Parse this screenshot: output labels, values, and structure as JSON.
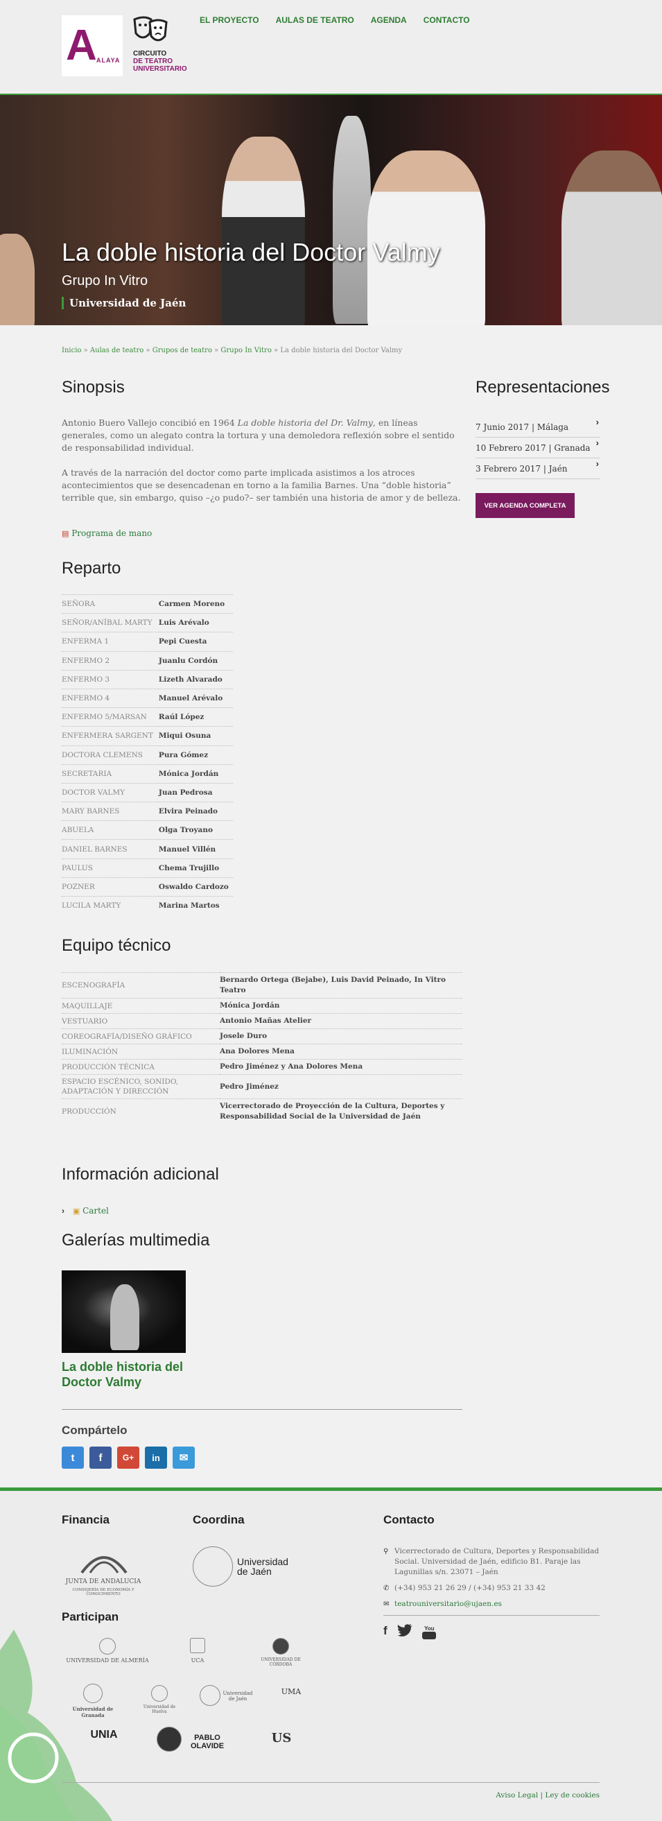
{
  "header": {
    "nav": [
      "EL PROYECTO",
      "AULAS DE TEATRO",
      "AGENDA",
      "CONTACTO"
    ],
    "logo_a_big": "A",
    "logo_a_text": "ALAYA",
    "logo_c_line1": "CIRCUITO",
    "logo_c_line2": "DE TEATRO",
    "logo_c_line3": "UNIVERSITARIO"
  },
  "hero": {
    "title": "La doble historia del Doctor Valmy",
    "group": "Grupo In Vitro",
    "university": "Universidad de Jaén"
  },
  "breadcrumb": {
    "items": [
      "Inicio",
      "Aulas de teatro",
      "Grupos de teatro",
      "Grupo In Vitro"
    ],
    "sep": " » ",
    "current": "La doble historia del Doctor Valmy"
  },
  "sinopsis": {
    "title": "Sinopsis",
    "p1_a": "Antonio Buero Vallejo  concibió en 1964 ",
    "p1_em": "La doble historia del Dr. Valmy",
    "p1_b": ", en líneas generales, como un alegato contra la tortura y una demoledora reflexión sobre el sentido de responsabilidad individual.",
    "p2": "A través de la narración del doctor como parte implicada asistimos a los atroces acontecimientos que se desencadenan en torno a la familia Barnes. Una “doble historia” terrible que, sin embargo, quiso –¿o pudo?– ser también una historia de amor y de belleza.",
    "programa": "Programa de mano"
  },
  "reparto": {
    "title": "Reparto",
    "rows": [
      [
        "SEÑORA",
        "Carmen Moreno"
      ],
      [
        "SEÑOR/ANÍBAL MARTY",
        "Luis Arévalo"
      ],
      [
        "ENFERMA 1",
        "Pepi Cuesta"
      ],
      [
        "ENFERMO 2",
        "Juanlu Cordón"
      ],
      [
        "ENFERMO 3",
        "Lizeth Alvarado"
      ],
      [
        "ENFERMO 4",
        "Manuel Arévalo"
      ],
      [
        "ENFERMO 5/MARSAN",
        "Raúl López"
      ],
      [
        "ENFERMERA SARGENT",
        "Miqui Osuna"
      ],
      [
        "DOCTORA CLEMENS",
        "Pura Gómez"
      ],
      [
        "SECRETARIA",
        "Mónica Jordán"
      ],
      [
        "DOCTOR VALMY",
        "Juan Pedrosa"
      ],
      [
        "MARY BARNES",
        "Elvira Peinado"
      ],
      [
        "ABUELA",
        "Olga Troyano"
      ],
      [
        "DANIEL BARNES",
        "Manuel Villén"
      ],
      [
        "PAULUS",
        "Chema Trujillo"
      ],
      [
        "POZNER",
        "Oswaldo Cardozo"
      ],
      [
        "LUCILA MARTY",
        "Marina Martos"
      ]
    ]
  },
  "equipo": {
    "title": "Equipo técnico",
    "rows": [
      [
        "ESCENOGRAFÍA",
        "Bernardo Ortega (Bejabe), Luis David Peinado, In Vitro Teatro"
      ],
      [
        "MAQUILLAJE",
        "Mónica Jordán"
      ],
      [
        "VESTUARIO",
        "Antonio Mañas Atelier"
      ],
      [
        "COREOGRAFÍA/DISEÑO GRÁFICO",
        "Josele Duro"
      ],
      [
        "ILUMINACIÓN",
        "Ana Dolores Mena"
      ],
      [
        "PRODUCCIÓN TÉCNICA",
        "Pedro Jiménez y Ana Dolores Mena"
      ],
      [
        "ESPACIO ESCÉNICO, SONIDO, ADAPTACIÓN Y DIRECCIÓN",
        "Pedro Jiménez"
      ],
      [
        "PRODUCCIÓN",
        "Vicerrectorado de Proyección de la Cultura, Deportes y Responsabilidad Social de la Universidad de Jaén"
      ]
    ]
  },
  "info": {
    "title": "Información adicional",
    "cartel": "Cartel"
  },
  "galerias": {
    "title": "Galerías multimedia",
    "caption": "La doble historia del Doctor Valmy"
  },
  "share": {
    "title": "Compártelo",
    "buttons": [
      "t",
      "f",
      "G+",
      "in",
      "✉"
    ]
  },
  "representaciones": {
    "title": "Representaciones",
    "items": [
      "7 Junio 2017 | Málaga",
      "10 Febrero 2017 | Granada",
      "3 Febrero 2017 | Jaén"
    ],
    "button": "VER AGENDA COMPLETA"
  },
  "footer": {
    "financia": "Financia",
    "financia_logo": "JUNTA DE ANDALUCIA",
    "financia_sub": "CONSEJERÍA DE ECONOMÍA Y CONOCIMIENTO",
    "coordina": "Coordina",
    "coordina_logo": "Universidad de Jaén",
    "participan": "Participan",
    "unis": [
      "UNIVERSIDAD DE ALMERÍA",
      "UCA",
      "UNIVERSIDAD DE CÓRDOBA",
      "Universidad de Granada",
      "Universidad de Huelva",
      "Universidad de Jaén",
      "UMA",
      "UNIA",
      "PABLO OLAVIDE",
      "US"
    ],
    "contacto": "Contacto",
    "address": "Vicerrectorado de Cultura, Deportes y Responsabilidad Social. Universidad de Jaén, edificio B1. Paraje las Lagunillas s/n. 23071 – Jaén",
    "phone": "(+34) 953 21 26 29 / (+34) 953 21 33 42",
    "email": "teatrouniversitario@ujaen.es",
    "legal": "Aviso Legal | Ley de cookies"
  }
}
